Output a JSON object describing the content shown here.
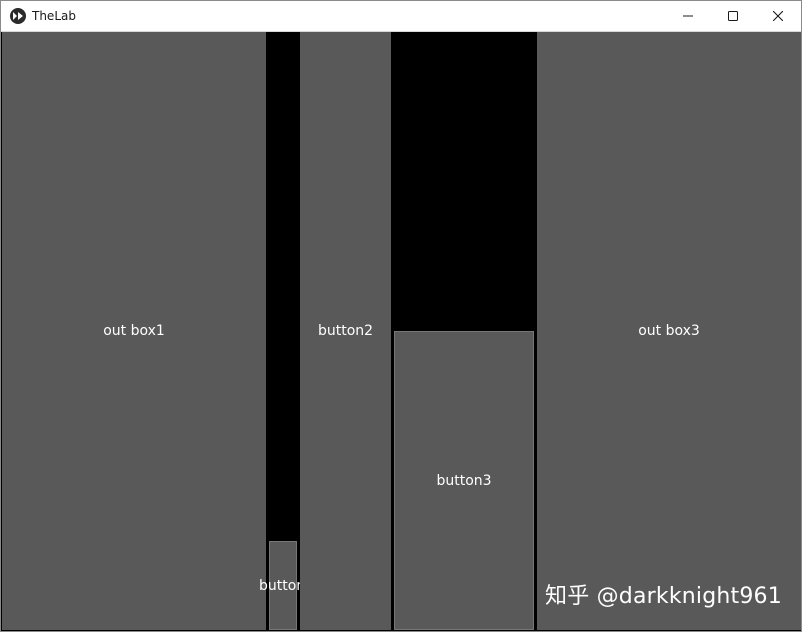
{
  "window": {
    "title": "TheLab"
  },
  "titlebar": {
    "minimize_icon": "minimize-icon",
    "maximize_icon": "maximize-icon",
    "close_icon": "close-icon"
  },
  "boxes": {
    "out_box1": "out box1",
    "button1": "button",
    "button2": "button2",
    "button3": "button3",
    "out_box3": "out box3"
  },
  "watermark": "知乎 @darkknight961",
  "colors": {
    "box_fill": "#595959",
    "background": "#000000",
    "text": "#ffffff"
  }
}
